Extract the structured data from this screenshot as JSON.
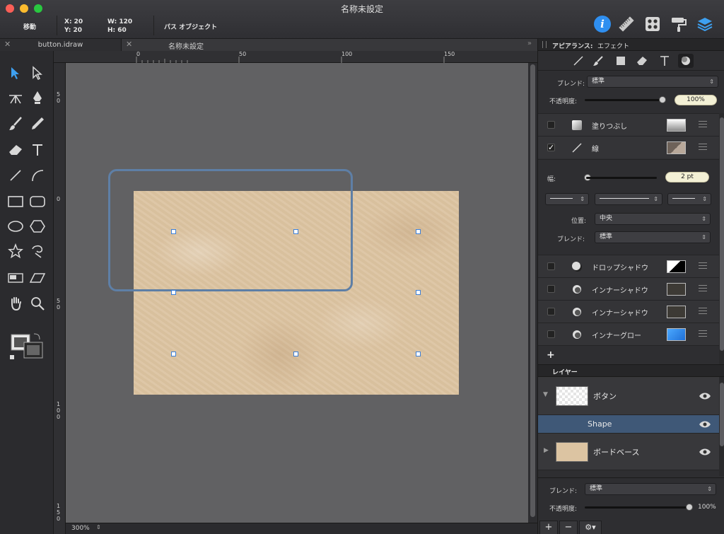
{
  "window": {
    "title": "名称未設定"
  },
  "toolbar": {
    "mode": "移動",
    "x": "X: 20",
    "y": "Y: 20",
    "w": "W: 120",
    "h": "H: 60",
    "object_type": "パス オブジェクト",
    "info_icon": "i"
  },
  "tabs": [
    {
      "label": "button.idraw"
    },
    {
      "label": "名称未設定"
    }
  ],
  "rulers": {
    "top": [
      "0",
      "50",
      "100",
      "150"
    ],
    "left": [
      "50",
      "0",
      "50",
      "100",
      "150"
    ]
  },
  "status": {
    "zoom": "300%"
  },
  "panel": {
    "header_title": "アピアランス:",
    "header_tab": "エフェクト",
    "blend_label": "ブレンド:",
    "blend_value": "標準",
    "opacity_label": "不透明度:",
    "opacity_value": "100%",
    "effects": [
      {
        "label": "塗りつぶし",
        "checked": false
      },
      {
        "label": "線",
        "checked": true
      }
    ],
    "stroke": {
      "width_label": "幅:",
      "width_value": "2 pt",
      "position_label": "位置:",
      "position_value": "中央",
      "blend_label": "ブレンド:",
      "blend_value": "標準"
    },
    "shadows": [
      {
        "label": "ドロップシャドウ"
      },
      {
        "label": "インナーシャドウ"
      },
      {
        "label": "インナーシャドウ"
      },
      {
        "label": "インナーグロー"
      }
    ],
    "add_label": "+"
  },
  "layers": {
    "header": "レイヤー",
    "items": [
      {
        "name": "ボタン"
      },
      {
        "name": "Shape"
      },
      {
        "name": "ボードベース"
      }
    ],
    "blend_label": "ブレンド:",
    "blend_value": "標準",
    "opacity_label": "不透明度:",
    "opacity_value": "100%",
    "add": "+",
    "remove": "−",
    "gear": "⚙▾"
  },
  "colors": {
    "accent": "#3b7fd8",
    "selection_row": "#3f5877",
    "stroke": "#5e7fa6"
  }
}
